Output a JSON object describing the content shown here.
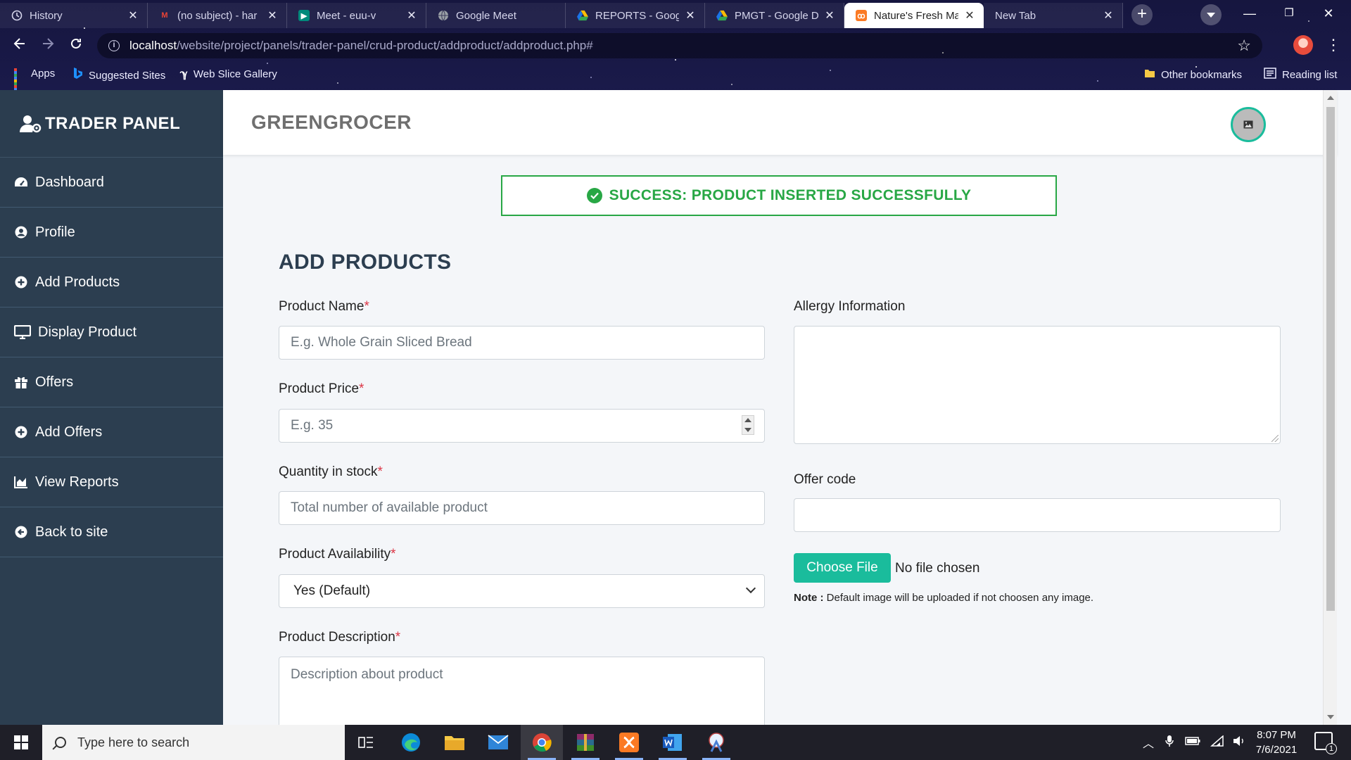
{
  "browser": {
    "tabs": [
      {
        "title": "History",
        "favicon": "history-icon",
        "color": "#9aa0a6"
      },
      {
        "title": "(no subject) - har",
        "favicon": "gmail-icon",
        "color": "#ea4335"
      },
      {
        "title": "Meet - euu-v",
        "favicon": "meet-icon",
        "color": "#00897b"
      },
      {
        "title": "Google Meet",
        "favicon": "globe-icon",
        "color": "#9aa0a6"
      },
      {
        "title": "REPORTS - Googl",
        "favicon": "drive-icon",
        "color": "#fbbc05"
      },
      {
        "title": "PMGT - Google D",
        "favicon": "drive-icon",
        "color": "#fbbc05"
      },
      {
        "title": "Nature's Fresh Ma",
        "favicon": "xampp-icon",
        "color": "#fb7a24"
      },
      {
        "title": "New Tab",
        "favicon": "",
        "color": ""
      }
    ],
    "url_host": "localhost",
    "url_path": "/website/project/panels/trader-panel/crud-product/addproduct/addproduct.php#",
    "bookmarks": {
      "apps": "Apps",
      "suggested": "Suggested Sites",
      "web_slice": "Web Slice Gallery",
      "other": "Other bookmarks",
      "reading": "Reading list"
    }
  },
  "sidebar": {
    "brand": "TRADER PANEL",
    "items": [
      {
        "label": "Dashboard",
        "icon": "dashboard-icon"
      },
      {
        "label": "Profile",
        "icon": "user-circle-icon"
      },
      {
        "label": "Add Products",
        "icon": "plus-circle-icon"
      },
      {
        "label": "Display Product",
        "icon": "monitor-icon"
      },
      {
        "label": "Offers",
        "icon": "gift-icon"
      },
      {
        "label": "Add Offers",
        "icon": "plus-circle-icon"
      },
      {
        "label": "View Reports",
        "icon": "chart-area-icon"
      },
      {
        "label": "Back to site",
        "icon": "arrow-circle-left-icon"
      }
    ]
  },
  "header": {
    "site_title": "GREENGROCER"
  },
  "alert": {
    "message": "SUCCESS: PRODUCT INSERTED SUCCESSFULLY",
    "color": "#28a745"
  },
  "form": {
    "title": "ADD PRODUCTS",
    "product_name": {
      "label": "Product Name",
      "required": "*",
      "placeholder": "E.g. Whole Grain Sliced Bread"
    },
    "product_price": {
      "label": "Product Price",
      "required": "*",
      "placeholder": "E.g. 35"
    },
    "quantity": {
      "label": "Quantity in stock",
      "required": "*",
      "placeholder": "Total number of available product"
    },
    "availability": {
      "label": "Product Availability",
      "required": "*",
      "selected": "Yes (Default)"
    },
    "description": {
      "label": "Product Description",
      "required": "*",
      "placeholder": "Description about product"
    },
    "allergy": {
      "label": "Allergy Information",
      "value": ""
    },
    "offer_code": {
      "label": "Offer code",
      "value": ""
    },
    "file": {
      "button": "Choose File",
      "status": "No file chosen"
    },
    "note": {
      "prefix": "Note :",
      "text": " Default image will be uploaded if not choosen any image."
    }
  },
  "taskbar": {
    "search_placeholder": "Type here to search",
    "time": "8:07 PM",
    "date": "7/6/2021",
    "notifications": "1"
  },
  "colors": {
    "sidebar": "#2c3e50",
    "accent": "#1abc9c",
    "required": "#dc3545"
  }
}
